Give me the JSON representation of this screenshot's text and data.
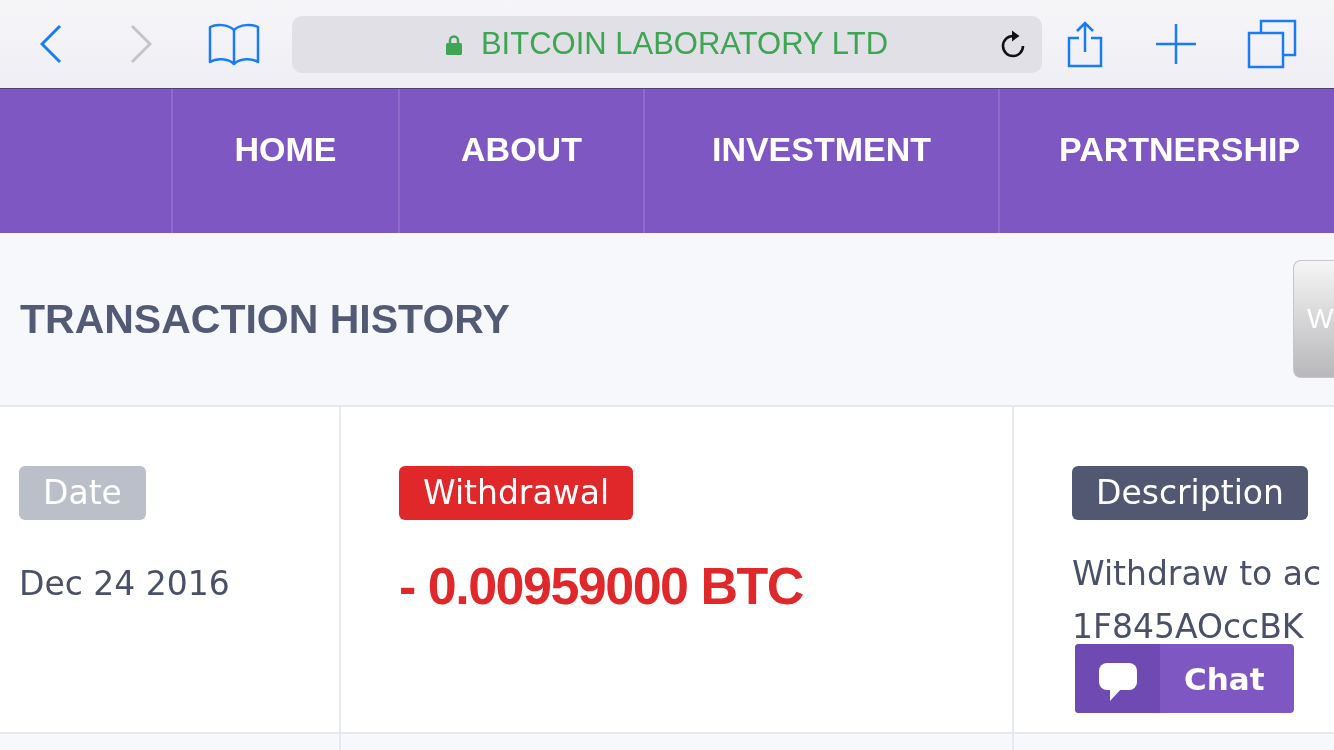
{
  "browser": {
    "nav_buttons": [
      {
        "kind": "back",
        "disabled": false
      },
      {
        "kind": "forward",
        "disabled": true
      }
    ],
    "address": "BITCOIN LABORATORY LTD"
  },
  "nav": {
    "items": [
      "HOME",
      "ABOUT",
      "INVESTMENT",
      "PARTNERSHIP"
    ]
  },
  "header": {
    "title": "TRANSACTION HISTORY",
    "button": "W"
  },
  "transaction": {
    "cells": [
      {
        "label": "Date",
        "color": "#bbbfca",
        "kind": "plain",
        "lines": [
          "Dec 24 2016"
        ]
      },
      {
        "label": "Withdrawal",
        "color": "#e0282a",
        "kind": "amount",
        "lines": [
          "- 0.00959000 BTC"
        ]
      },
      {
        "label": "Description",
        "color": "#535872",
        "kind": "text",
        "lines": [
          "Withdraw to ac",
          "1F845AOccBK"
        ]
      }
    ]
  },
  "chat": {
    "label": "Chat"
  }
}
